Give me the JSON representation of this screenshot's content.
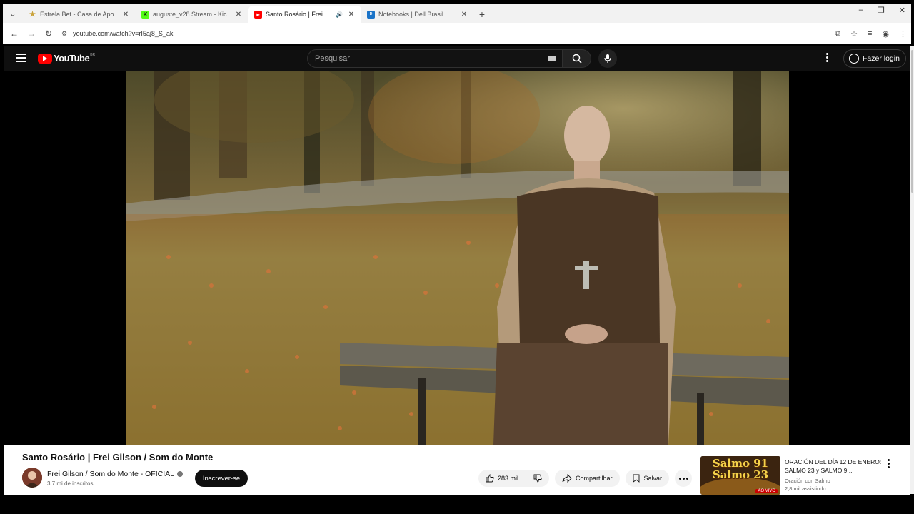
{
  "browser": {
    "tabs": [
      {
        "title": "Estrela Bet - Casa de Aposta Esp",
        "favicon": "star-favicon",
        "active": false
      },
      {
        "title": "auguste_v28 Stream - Kick Dash",
        "favicon": "kick-favicon",
        "active": false
      },
      {
        "title": "Santo Rosário | Frei Gilson /",
        "favicon": "youtube-favicon",
        "active": true,
        "playing_audio": true
      },
      {
        "title": "Notebooks | Dell Brasil",
        "favicon": "dell-favicon",
        "active": false
      }
    ],
    "new_tab_label": "+",
    "url": "youtube.com/watch?v=rI5aj8_S_ak",
    "colors": {
      "tabstrip": "#f2f2f2",
      "toolbar": "#ffffff"
    }
  },
  "youtube": {
    "logo_text": "YouTube",
    "logo_region": "BR",
    "search_placeholder": "Pesquisar",
    "login_label": "Fazer login",
    "colors": {
      "header": "#0f0f0f",
      "brand_red": "#ff0000"
    }
  },
  "video": {
    "title": "Santo Rosário | Frei Gilson / Som do Monte",
    "channel": "Frei Gilson / Som do Monte - OFICIAL",
    "subscribers": "3,7 mi de inscritos",
    "subscribe_label": "Inscrever-se",
    "likes": "283 mil",
    "share_label": "Compartilhar",
    "save_label": "Salvar"
  },
  "recommendation": {
    "thumb_line1": "Salmo 91",
    "thumb_line2": "Salmo 23",
    "live_badge": "AO VIVO",
    "title": "ORACIÓN DEL DÍA 12 DE ENERO: SALMO 23 y SALMO 9...",
    "channel": "Oración con Salmo",
    "viewers": "2,8 mil assistindo"
  }
}
